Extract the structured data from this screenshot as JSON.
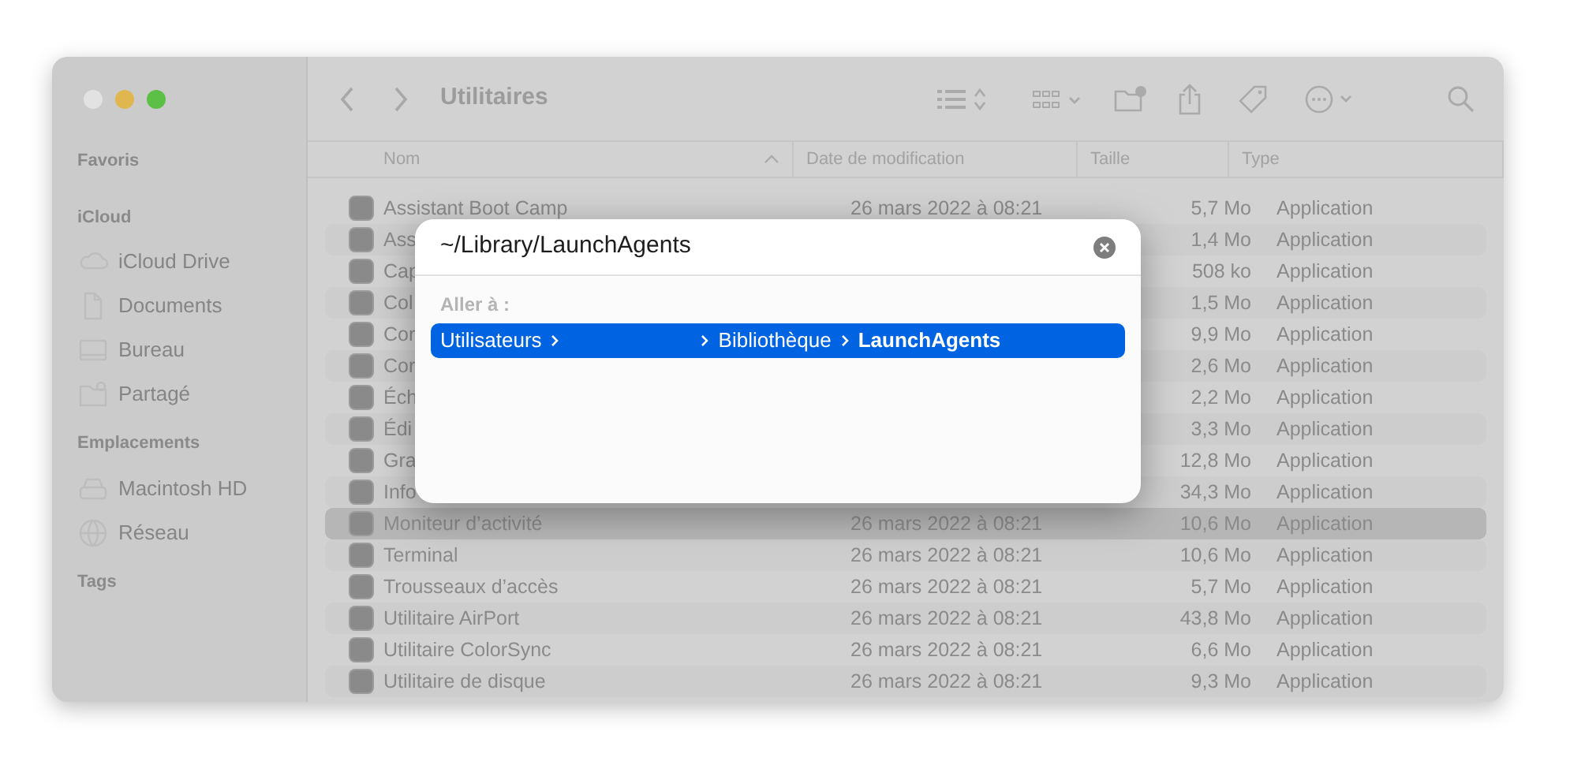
{
  "window": {
    "title": "Utilitaires"
  },
  "sidebar": {
    "sections": [
      {
        "title": "Favoris"
      },
      {
        "title": "iCloud",
        "items": [
          {
            "label": "iCloud Drive",
            "kind": "cloud"
          },
          {
            "label": "Documents",
            "kind": "document"
          },
          {
            "label": "Bureau",
            "kind": "desktop"
          },
          {
            "label": "Partagé",
            "kind": "shared"
          }
        ]
      },
      {
        "title": "Emplacements",
        "items": [
          {
            "label": "Macintosh HD",
            "kind": "disk"
          },
          {
            "label": "Réseau",
            "kind": "network"
          }
        ]
      },
      {
        "title": "Tags"
      }
    ]
  },
  "table": {
    "columns": [
      {
        "label": "Nom",
        "sorted": true
      },
      {
        "label": "Date de modification",
        "sorted": false
      },
      {
        "label": "Taille",
        "sorted": false
      },
      {
        "label": "Type",
        "sorted": false
      }
    ],
    "rows": [
      {
        "name": "Assistant Boot Camp",
        "date": "26 mars 2022 à 08:21",
        "size": "5,7 Mo",
        "type": "Application",
        "selected": false
      },
      {
        "name": "Ass",
        "size": "1,4 Mo",
        "type": "Application",
        "selected": false
      },
      {
        "name": "Cap",
        "size": "508 ko",
        "type": "Application",
        "selected": false
      },
      {
        "name": "Col",
        "size": "1,5 Mo",
        "type": "Application",
        "selected": false
      },
      {
        "name": "Cor",
        "size": "9,9 Mo",
        "type": "Application",
        "selected": false
      },
      {
        "name": "Cor",
        "size": "2,6 Mo",
        "type": "Application",
        "selected": false
      },
      {
        "name": "Éch",
        "size": "2,2 Mo",
        "type": "Application",
        "selected": false
      },
      {
        "name": "Édi",
        "size": "3,3 Mo",
        "type": "Application",
        "selected": false
      },
      {
        "name": "Gra",
        "size": "12,8 Mo",
        "type": "Application",
        "selected": false
      },
      {
        "name": "Info",
        "size": "34,3 Mo",
        "type": "Application",
        "selected": false
      },
      {
        "name": "Moniteur d’activité",
        "date": "26 mars 2022 à 08:21",
        "size": "10,6 Mo",
        "type": "Application",
        "selected": true
      },
      {
        "name": "Terminal",
        "date": "26 mars 2022 à 08:21",
        "size": "10,6 Mo",
        "type": "Application",
        "selected": false
      },
      {
        "name": "Trousseaux d’accès",
        "date": "26 mars 2022 à 08:21",
        "size": "5,7 Mo",
        "type": "Application",
        "selected": false
      },
      {
        "name": "Utilitaire AirPort",
        "date": "26 mars 2022 à 08:21",
        "size": "43,8 Mo",
        "type": "Application",
        "selected": false
      },
      {
        "name": "Utilitaire ColorSync",
        "date": "26 mars 2022 à 08:21",
        "size": "6,6 Mo",
        "type": "Application",
        "selected": false
      },
      {
        "name": "Utilitaire de disque",
        "date": "26 mars 2022 à 08:21",
        "size": "9,3 Mo",
        "type": "Application",
        "selected": false
      }
    ]
  },
  "go_to_dialog": {
    "value": "~/Library/LaunchAgents",
    "section_label": "Aller à :",
    "suggestions": [
      {
        "selected": true,
        "segments": [
          {
            "kind": "folder",
            "label": "Utilisateurs"
          },
          {
            "kind": "blank"
          },
          {
            "kind": "folder",
            "label": "Bibliothèque"
          },
          {
            "kind": "current",
            "label": "LaunchAgents"
          }
        ]
      }
    ]
  }
}
